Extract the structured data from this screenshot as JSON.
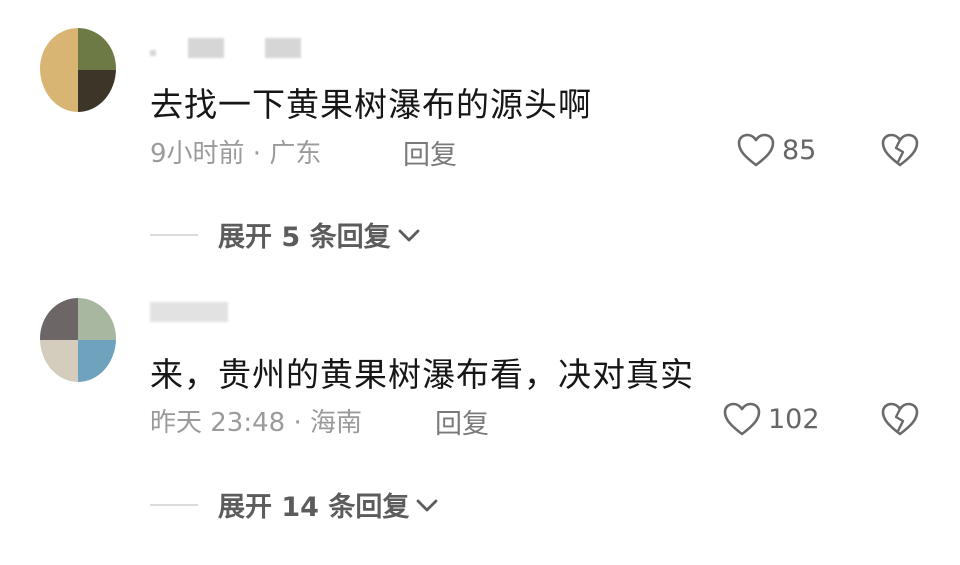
{
  "comments": [
    {
      "text": "去找一下黄果树瀑布的源头啊",
      "time": "9小时前",
      "sep": " · ",
      "location": "广东",
      "reply_label": "回复",
      "likes": "85",
      "expand_label": "展开 5 条回复",
      "avatar_colors": [
        "#d8b573",
        "#6e7a45",
        "#c9ab70",
        "#3c3528"
      ]
    },
    {
      "text": "来，贵州的黄果树瀑布看，决对真实",
      "time": "昨天 23:48",
      "sep": " · ",
      "location": "海南",
      "reply_label": "回复",
      "likes": "102",
      "expand_label": "展开 14 条回复",
      "avatar_colors": [
        "#6c6666",
        "#a8b8a0",
        "#d4cdbd",
        "#6fa2bd"
      ]
    }
  ],
  "icons": {
    "like": "heart-outline-icon",
    "dislike": "broken-heart-icon",
    "expand": "chevron-down-icon"
  },
  "colors": {
    "text": "#161616",
    "meta": "#9b9b9b",
    "expand": "#5c5c5c"
  }
}
